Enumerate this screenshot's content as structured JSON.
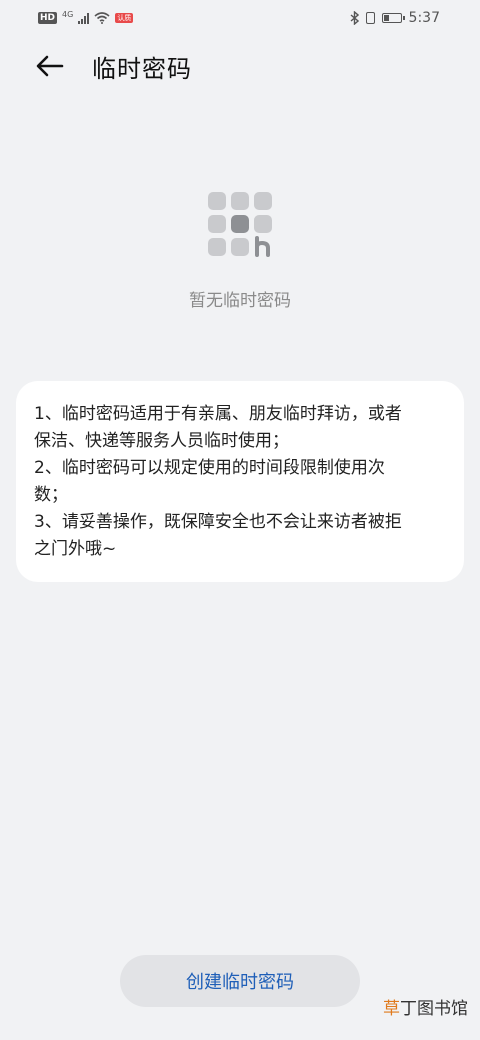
{
  "status_bar": {
    "hd": "HD",
    "network": "4G",
    "carrier_badge": "认质",
    "time": "5:37",
    "battery_level_pct": 35
  },
  "header": {
    "back_icon": "arrow-left-icon",
    "title": "临时密码"
  },
  "empty_state": {
    "icon": "keypad-icon",
    "text": "暂无临时密码"
  },
  "info": {
    "lines": [
      "1、临时密码适用于有亲属、朋友临时拜访，或者",
      "保洁、快递等服务人员临时使用；",
      "2、临时密码可以规定使用的时间段限制使用次",
      "数；",
      "3、请妥善操作，既保障安全也不会让来访者被拒",
      "之门外哦~"
    ]
  },
  "create_button": {
    "label": "创建临时密码"
  },
  "watermark": {
    "accent": "草",
    "rest": "丁图书馆"
  },
  "colors": {
    "background": "#f1f2f4",
    "card": "#ffffff",
    "button_bg": "#e2e3e6",
    "button_text": "#1f5fb8",
    "muted_text": "#8a8a8a"
  }
}
